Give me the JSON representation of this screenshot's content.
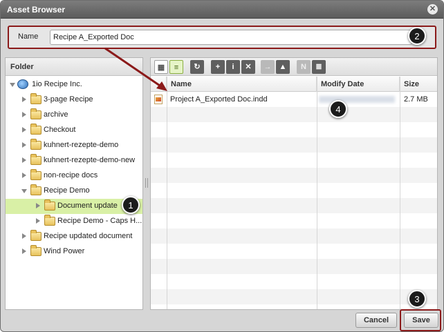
{
  "window": {
    "title": "Asset Browser",
    "close_icon": "close-icon"
  },
  "name_field": {
    "label": "Name",
    "value": "Recipe A_Exported Doc"
  },
  "folder_panel": {
    "header": "Folder",
    "tree": [
      {
        "label": "1io Recipe Inc.",
        "icon": "globe-icon",
        "expanded": true,
        "level": 0
      },
      {
        "label": "3-page Recipe",
        "icon": "folder-icon",
        "level": 1
      },
      {
        "label": "archive",
        "icon": "folder-icon",
        "level": 1
      },
      {
        "label": "Checkout",
        "icon": "folder-icon",
        "level": 1
      },
      {
        "label": "kuhnert-rezepte-demo",
        "icon": "folder-icon",
        "level": 1
      },
      {
        "label": "kuhnert-rezepte-demo-new",
        "icon": "folder-icon",
        "level": 1
      },
      {
        "label": "non-recipe docs",
        "icon": "folder-icon",
        "level": 1
      },
      {
        "label": "Recipe Demo",
        "icon": "folder-open-icon",
        "expanded": true,
        "level": 1
      },
      {
        "label": "Document update",
        "icon": "folder-icon",
        "level": 2,
        "selected": true
      },
      {
        "label": "Recipe Demo - Caps H...",
        "icon": "folder-icon",
        "level": 2
      },
      {
        "label": "Recipe updated document",
        "icon": "folder-icon",
        "level": 1
      },
      {
        "label": "Wind Power",
        "icon": "folder-icon",
        "level": 1
      }
    ]
  },
  "toolbar": {
    "buttons": [
      {
        "name": "thumbnail-view-icon",
        "glyph": "▦"
      },
      {
        "name": "list-view-icon",
        "glyph": "≡",
        "active": true
      },
      {
        "name": "refresh-icon",
        "glyph": "↻"
      },
      {
        "name": "new-folder-icon",
        "glyph": "+"
      },
      {
        "name": "info-icon",
        "glyph": "i"
      },
      {
        "name": "delete-icon",
        "glyph": "✕"
      },
      {
        "name": "move-folder-icon",
        "glyph": "→",
        "disabled": true
      },
      {
        "name": "upload-icon",
        "glyph": "▲"
      },
      {
        "name": "indesign-icon",
        "glyph": "N",
        "disabled": true
      },
      {
        "name": "archive-icon",
        "glyph": "≣"
      }
    ]
  },
  "file_table": {
    "columns": [
      "Name",
      "Modify Date",
      "Size"
    ],
    "rows": [
      {
        "name": "Project A_Exported Doc.indd",
        "modify_date": "",
        "size": "2.7 MB"
      }
    ]
  },
  "footer": {
    "cancel_label": "Cancel",
    "save_label": "Save"
  },
  "callouts": [
    "1",
    "2",
    "3",
    "4"
  ],
  "colors": {
    "highlight": "#8b1a1a",
    "selection": "#d9f0a6"
  }
}
